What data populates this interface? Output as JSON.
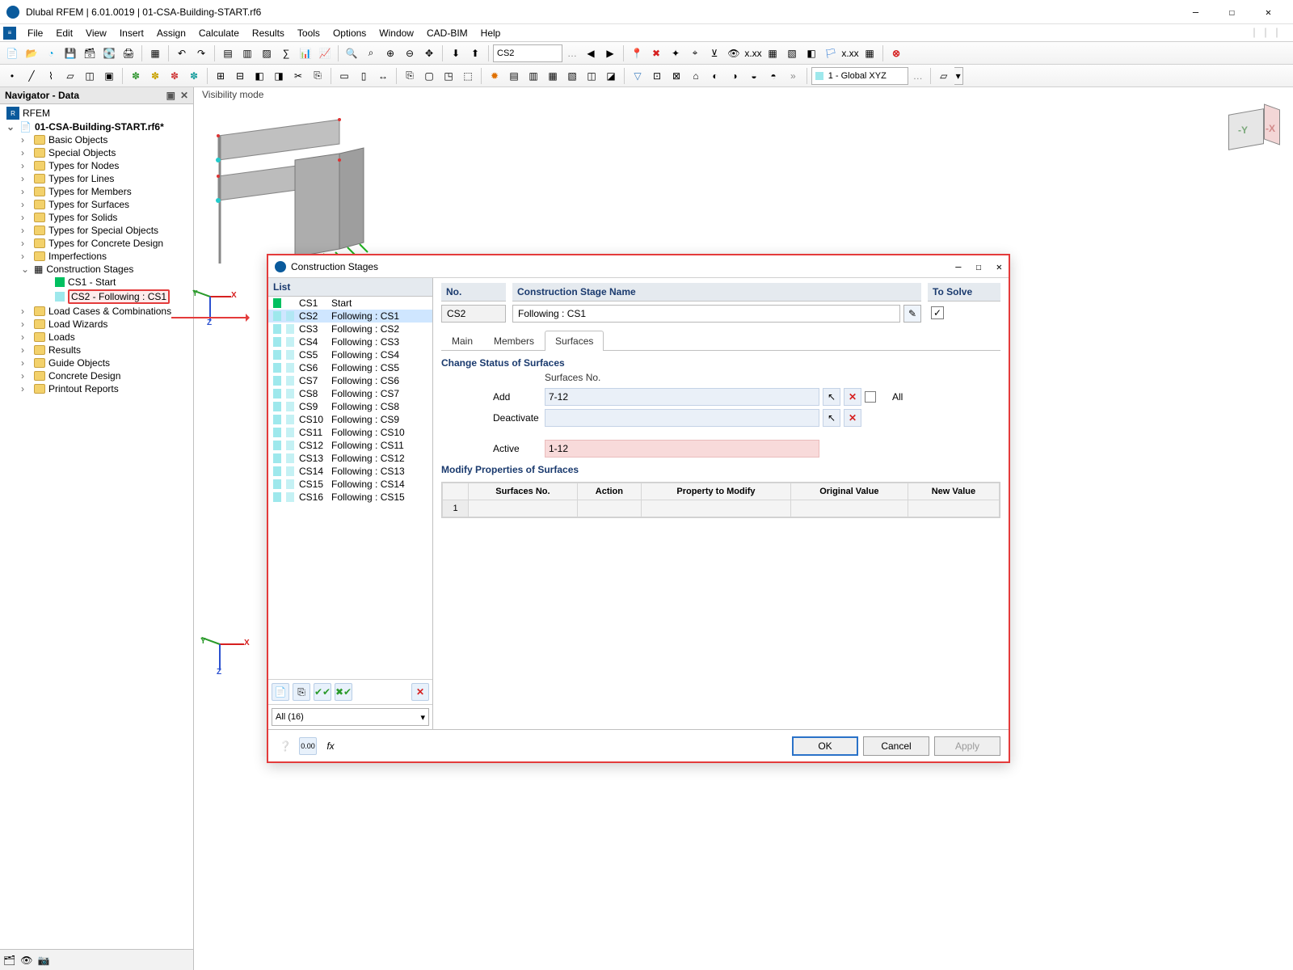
{
  "title": "Dlubal RFEM | 6.01.0019 | 01-CSA-Building-START.rf6",
  "menu": [
    "File",
    "Edit",
    "View",
    "Insert",
    "Assign",
    "Calculate",
    "Results",
    "Tools",
    "Options",
    "Window",
    "CAD-BIM",
    "Help"
  ],
  "visibility_label": "Visibility mode",
  "combo_cs": "CS2",
  "combo_coord": "1 - Global XYZ",
  "navigator": {
    "title": "Navigator - Data",
    "root": "RFEM",
    "project": "01-CSA-Building-START.rf6*",
    "folders": [
      "Basic Objects",
      "Special Objects",
      "Types for Nodes",
      "Types for Lines",
      "Types for Members",
      "Types for Surfaces",
      "Types for Solids",
      "Types for Special Objects",
      "Types for Concrete Design",
      "Imperfections"
    ],
    "cs_node": "Construction Stages",
    "cs_children": [
      {
        "swatch": "g",
        "label": "CS1 - Start"
      },
      {
        "swatch": "c",
        "label": "CS2 - Following : CS1",
        "hl": true
      }
    ],
    "folders_after": [
      "Load Cases & Combinations",
      "Load Wizards",
      "Loads",
      "Results",
      "Guide Objects",
      "Concrete Design",
      "Printout Reports"
    ]
  },
  "dialog": {
    "title": "Construction Stages",
    "list_label": "List",
    "no_label": "No.",
    "no_value": "CS2",
    "name_label": "Construction Stage Name",
    "name_value": "Following : CS1",
    "solve_label": "To Solve",
    "solve_checked": true,
    "tabs": [
      "Main",
      "Members",
      "Surfaces"
    ],
    "active_tab": 2,
    "section_change": "Change Status of Surfaces",
    "col_surfno": "Surfaces No.",
    "row_add": "Add",
    "row_add_val": "7-12",
    "row_deact": "Deactivate",
    "row_deact_val": "",
    "row_active": "Active",
    "row_active_val": "1-12",
    "all_label": "All",
    "section_modify": "Modify Properties of Surfaces",
    "mod_columns": [
      "",
      "Surfaces No.",
      "Action",
      "Property to Modify",
      "Original Value",
      "New Value"
    ],
    "mod_row": "1",
    "list_filter": "All (16)",
    "buttons": {
      "ok": "OK",
      "cancel": "Cancel",
      "apply": "Apply"
    },
    "cs_list": [
      {
        "id": "CS1",
        "name": "Start",
        "sw": "g"
      },
      {
        "id": "CS2",
        "name": "Following : CS1",
        "sw": "c",
        "selected": true
      },
      {
        "id": "CS3",
        "name": "Following : CS2",
        "sw": "c"
      },
      {
        "id": "CS4",
        "name": "Following : CS3",
        "sw": "c"
      },
      {
        "id": "CS5",
        "name": "Following : CS4",
        "sw": "c"
      },
      {
        "id": "CS6",
        "name": "Following : CS5",
        "sw": "c"
      },
      {
        "id": "CS7",
        "name": "Following : CS6",
        "sw": "c"
      },
      {
        "id": "CS8",
        "name": "Following : CS7",
        "sw": "c"
      },
      {
        "id": "CS9",
        "name": "Following : CS8",
        "sw": "c"
      },
      {
        "id": "CS10",
        "name": "Following : CS9",
        "sw": "c"
      },
      {
        "id": "CS11",
        "name": "Following : CS10",
        "sw": "c"
      },
      {
        "id": "CS12",
        "name": "Following : CS11",
        "sw": "c"
      },
      {
        "id": "CS13",
        "name": "Following : CS12",
        "sw": "c"
      },
      {
        "id": "CS14",
        "name": "Following : CS13",
        "sw": "c"
      },
      {
        "id": "CS15",
        "name": "Following : CS14",
        "sw": "c"
      },
      {
        "id": "CS16",
        "name": "Following : CS15",
        "sw": "c"
      }
    ]
  }
}
